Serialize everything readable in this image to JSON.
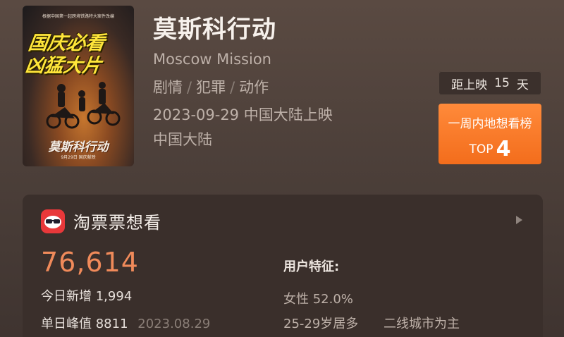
{
  "movie": {
    "title": "莫斯科行动",
    "english_title": "Moscow Mission",
    "genres": [
      "剧情",
      "犯罪",
      "动作"
    ],
    "genre_separator": "/",
    "release": "2023-09-29 中国大陆上映",
    "region": "中国大陆"
  },
  "poster": {
    "top_text": "根据中国第一起跨境铁路特大案件改编",
    "slogan_line1": "国庆必看",
    "slogan_line2": "凶猛大片",
    "name": "莫斯科行动",
    "date": "9月29日 国庆献映"
  },
  "countdown": {
    "label": "距上映",
    "days": "15",
    "unit": "天"
  },
  "ranking": {
    "title": "一周内地想看榜",
    "prefix": "TOP",
    "rank": "4"
  },
  "want_card": {
    "title": "淘票票想看",
    "count": "76,614",
    "today_label": "今日新增",
    "today_value": "1,994",
    "peak_label": "单日峰值",
    "peak_value": "8811",
    "peak_date": "2023.08.29",
    "features_label": "用户特征:",
    "gender": "女性 52.0%",
    "age": "25-29岁居多",
    "city": "二线城市为主"
  },
  "colors": {
    "accent_orange": "#f36d1c",
    "count_orange": "#f08a5a",
    "app_red": "#e8383a"
  }
}
